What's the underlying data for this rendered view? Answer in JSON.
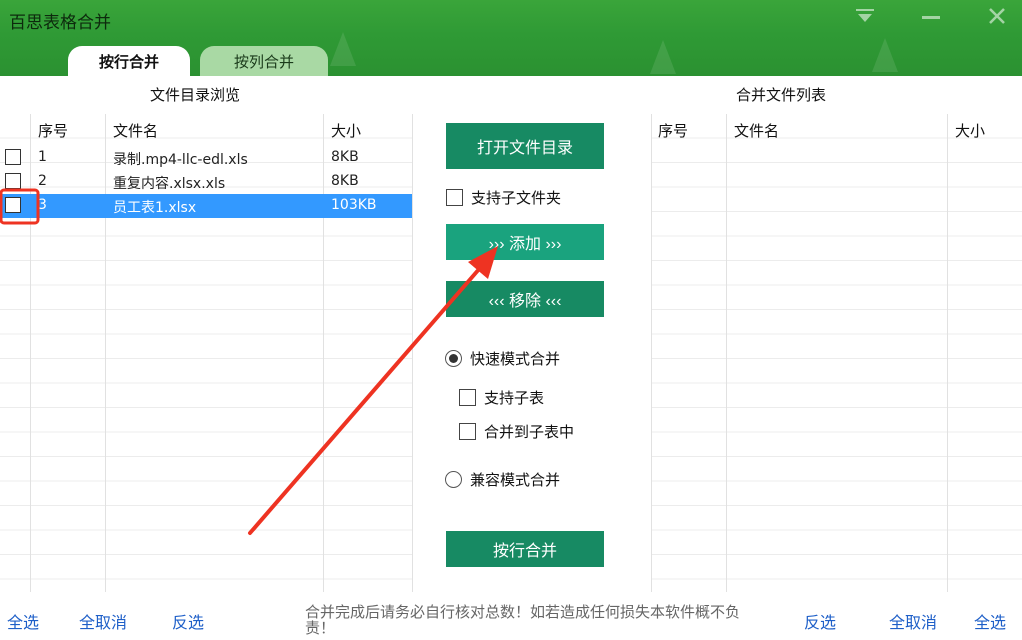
{
  "window": {
    "title": "百思表格合并",
    "controls": [
      "dropdown-icon",
      "minimize-icon",
      "close-icon"
    ]
  },
  "tabs": [
    {
      "label": "按行合并",
      "active": true
    },
    {
      "label": "按列合并",
      "active": false
    }
  ],
  "left_panel": {
    "title": "文件目录浏览",
    "columns": {
      "index": "序号",
      "name": "文件名",
      "size": "大小"
    },
    "rows": [
      {
        "index": "1",
        "name": "录制.mp4-llc-edl.xls",
        "size": "8KB",
        "checked": false,
        "selected": false
      },
      {
        "index": "2",
        "name": "重复内容.xlsx.xls",
        "size": "8KB",
        "checked": false,
        "selected": false
      },
      {
        "index": "3",
        "name": "员工表1.xlsx",
        "size": "103KB",
        "checked": false,
        "selected": true
      }
    ]
  },
  "right_panel": {
    "title": "合并文件列表",
    "columns": {
      "index": "序号",
      "name": "文件名",
      "size": "大小"
    }
  },
  "controls": {
    "open_dir": "打开文件目录",
    "include_subfolders": {
      "label": "支持子文件夹",
      "checked": false
    },
    "add": "››› 添加 ›››",
    "remove": "‹‹‹ 移除 ‹‹‹",
    "fast_mode": {
      "label": "快速模式合并",
      "selected": true
    },
    "support_subsheet": {
      "label": "支持子表",
      "checked": false
    },
    "merge_to_subsheet": {
      "label": "合并到子表中",
      "checked": false
    },
    "compat_mode": {
      "label": "兼容模式合并",
      "selected": false
    },
    "merge_rows": "按行合并"
  },
  "footer": {
    "left": {
      "select_all": "全选",
      "deselect_all": "全取消",
      "invert": "反选"
    },
    "note": "合并完成后请务必自行核对总数！如若造成任何损失本软件概不负责！",
    "right": {
      "invert": "反选",
      "deselect_all": "全取消",
      "select_all": "全选"
    }
  },
  "colors": {
    "title_green": "#2f9a35",
    "button_teal": "#1aa37e",
    "button_dark": "#178a63",
    "selection_blue": "#3399ff",
    "link_blue": "#1e5fc8",
    "annotation_red": "#ee3322"
  }
}
